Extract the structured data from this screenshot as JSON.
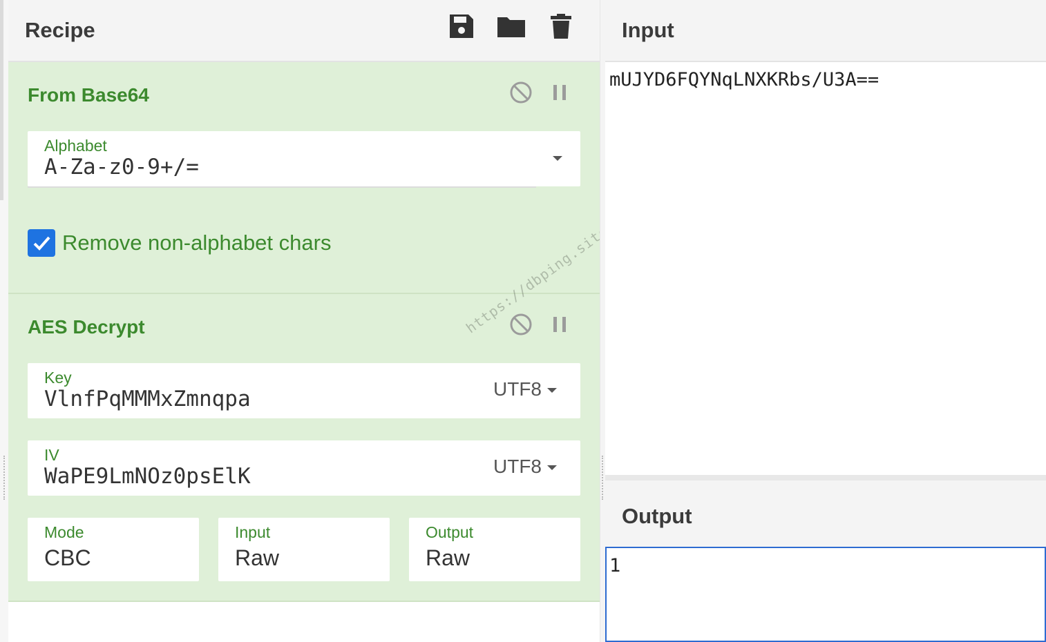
{
  "recipe": {
    "title": "Recipe",
    "actions": [
      {
        "name": "save-recipe",
        "icon": "save-icon"
      },
      {
        "name": "load-recipe",
        "icon": "folder-icon"
      },
      {
        "name": "clear-recipe",
        "icon": "trash-icon"
      }
    ]
  },
  "operations": [
    {
      "title": "From Base64",
      "alphabet": {
        "label": "Alphabet",
        "value": "A-Za-z0-9+/="
      },
      "remove_non_alphabet": {
        "label": "Remove non-alphabet chars",
        "checked": true
      }
    },
    {
      "title": "AES Decrypt",
      "key": {
        "label": "Key",
        "value": "VlnfPqMMMxZmnqpa",
        "encoding": "UTF8"
      },
      "iv": {
        "label": "IV",
        "value": "WaPE9LmNOz0psElK",
        "encoding": "UTF8"
      },
      "mode": {
        "label": "Mode",
        "value": "CBC"
      },
      "input": {
        "label": "Input",
        "value": "Raw"
      },
      "output": {
        "label": "Output",
        "value": "Raw"
      }
    }
  ],
  "input": {
    "title": "Input",
    "text": "mUJYD6FQYNqLNXKRbs/U3A=="
  },
  "output": {
    "title": "Output",
    "text": "1"
  },
  "watermark": "https://dbping.site",
  "colors": {
    "accent_green": "#3c8a2e",
    "op_background": "#dff0d8",
    "checkbox_blue": "#1e73e1",
    "output_border": "#2d6bd1"
  }
}
